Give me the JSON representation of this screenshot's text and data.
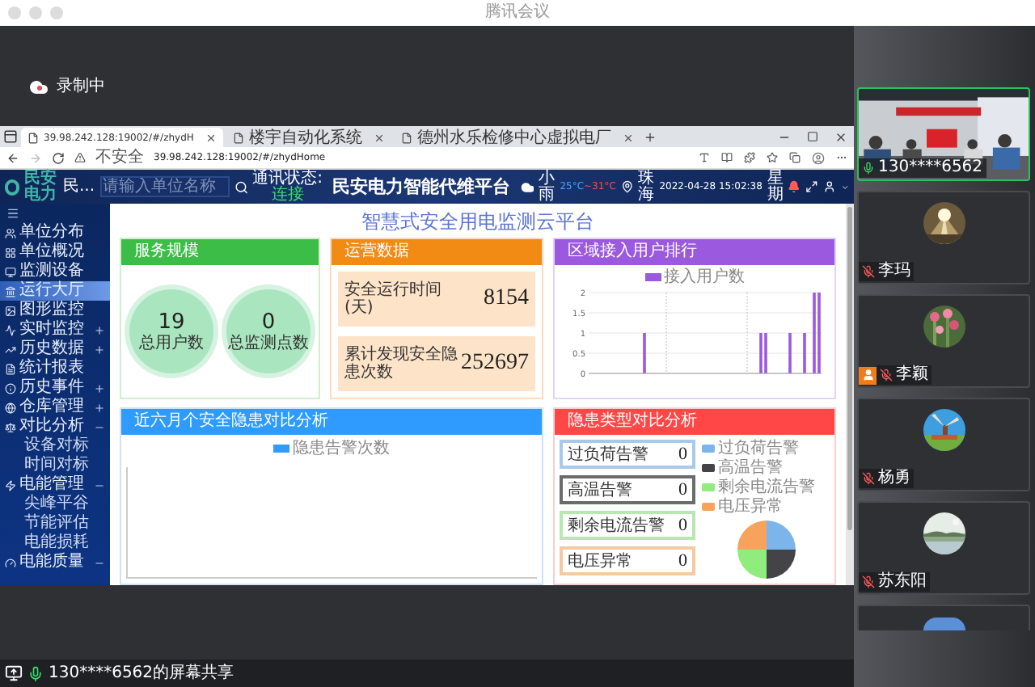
{
  "app_window": {
    "title": "腾讯会议"
  },
  "recording": {
    "label": "录制中"
  },
  "browser": {
    "tabs": [
      {
        "title": "39.98.242.128:19002/#/zhydH",
        "selected": true
      },
      {
        "title": "楼宇自动化系统",
        "selected": false
      },
      {
        "title": "德州水乐检修中心虚拟电厂",
        "selected": false
      }
    ],
    "security_label": "不安全",
    "address": "39.98.242.128:19002/#/zhydHome"
  },
  "header": {
    "logo": "民安电力",
    "unit": "民...",
    "search": {
      "placeholder": "请输入单位名称"
    },
    "status_label": "通讯状态:",
    "status_value": "连接",
    "title": "民安电力智能代维平台",
    "weather": "小雨",
    "temp_low": "25°C",
    "temp_high": "~31°C",
    "location": "珠海",
    "datetime": "2022-04-28 15:02:38",
    "weekday": "星期"
  },
  "sidebar": {
    "items": [
      {
        "label": "单位分布",
        "kind": "link",
        "selected": false
      },
      {
        "label": "单位概况",
        "kind": "link",
        "selected": false
      },
      {
        "label": "监测设备",
        "kind": "link",
        "selected": false
      },
      {
        "label": "运行大厅",
        "kind": "link",
        "selected": true
      },
      {
        "label": "图形监控",
        "kind": "link",
        "selected": false
      },
      {
        "label": "实时监控",
        "kind": "group",
        "selected": false,
        "expanded": false
      },
      {
        "label": "历史数据",
        "kind": "group",
        "selected": false,
        "expanded": false
      },
      {
        "label": "统计报表",
        "kind": "link",
        "selected": false
      },
      {
        "label": "历史事件",
        "kind": "group",
        "selected": false,
        "expanded": false
      },
      {
        "label": "仓库管理",
        "kind": "group",
        "selected": false,
        "expanded": false
      },
      {
        "label": "对比分析",
        "kind": "group",
        "selected": false,
        "expanded": true,
        "children": [
          {
            "label": "设备对标",
            "selected": false
          },
          {
            "label": "时间对标",
            "selected": false
          }
        ]
      },
      {
        "label": "电能管理",
        "kind": "group",
        "selected": false,
        "expanded": true,
        "children": [
          {
            "label": "尖峰平谷",
            "selected": false
          },
          {
            "label": "节能评估",
            "selected": false
          },
          {
            "label": "电能损耗",
            "selected": false
          }
        ]
      },
      {
        "label": "电能质量",
        "kind": "group",
        "selected": false,
        "expanded": true
      }
    ]
  },
  "main": {
    "title": "智慧式安全用电监测云平台",
    "service_panel": {
      "title": "服务规模",
      "stats": [
        {
          "value": "19",
          "label": "总用户数"
        },
        {
          "value": "0",
          "label": "总监测点数"
        }
      ]
    },
    "operations_panel": {
      "title": "运营数据",
      "rows": [
        {
          "label": "安全运行时间(天)",
          "value": "8154"
        },
        {
          "label": "累计发现安全隐患次数",
          "value": "252697"
        }
      ]
    },
    "ranking_panel": {
      "title": "区域接入用户排行",
      "chart_data": {
        "type": "bar",
        "grid": true,
        "ylim": [
          0,
          2
        ],
        "yticks": [
          0,
          0.5,
          1,
          1.5,
          2
        ],
        "series": [
          {
            "name": "接入用户数",
            "color": "#9b59e0",
            "values": [
              0,
              0,
              0,
              0,
              0,
              0,
              0,
              0,
              0,
              0,
              0,
              1,
              0,
              0,
              0,
              0,
              0,
              0,
              0,
              0,
              0,
              0,
              0,
              0,
              0,
              0,
              0,
              0,
              0,
              0,
              0,
              0,
              0,
              0,
              0,
              1,
              1,
              0,
              0,
              0,
              0,
              1,
              0,
              0,
              1,
              0,
              2,
              2
            ]
          }
        ]
      }
    },
    "trend_panel": {
      "title": "近六月个安全隐患对比分析",
      "legend": "隐患告警次数"
    },
    "hazard_panel": {
      "title": "隐患类型对比分析",
      "alerts": [
        {
          "label": "过负荷告警",
          "value": "0",
          "color": "#a9c9ec"
        },
        {
          "label": "高温告警",
          "value": "0",
          "color": "#6b6b6b"
        },
        {
          "label": "剩余电流告警",
          "value": "0",
          "color": "#b7e8b0"
        },
        {
          "label": "电压异常",
          "value": "0",
          "color": "#f6c9a0"
        }
      ],
      "legend": [
        {
          "label": "过负荷告警",
          "color": "#7cb5ec"
        },
        {
          "label": "高温告警",
          "color": "#434348"
        },
        {
          "label": "剩余电流告警",
          "color": "#90ed7d"
        },
        {
          "label": "电压异常",
          "color": "#f7a35c"
        }
      ]
    }
  },
  "participants": [
    {
      "name": "130****6562",
      "kind": "video",
      "muted": false,
      "speaking": true,
      "role_badge": false
    },
    {
      "name": "李玛",
      "kind": "sun",
      "muted": true,
      "speaking": false,
      "role_badge": false
    },
    {
      "name": "李颖",
      "kind": "flower",
      "muted": true,
      "speaking": false,
      "role_badge": true
    },
    {
      "name": "杨勇",
      "kind": "windmill",
      "muted": true,
      "speaking": false,
      "role_badge": false
    },
    {
      "name": "苏东阳",
      "kind": "lake",
      "muted": true,
      "speaking": false,
      "role_badge": false
    }
  ],
  "more_participants_below": true,
  "screen_share": {
    "label": "130****6562的屏幕共享"
  }
}
